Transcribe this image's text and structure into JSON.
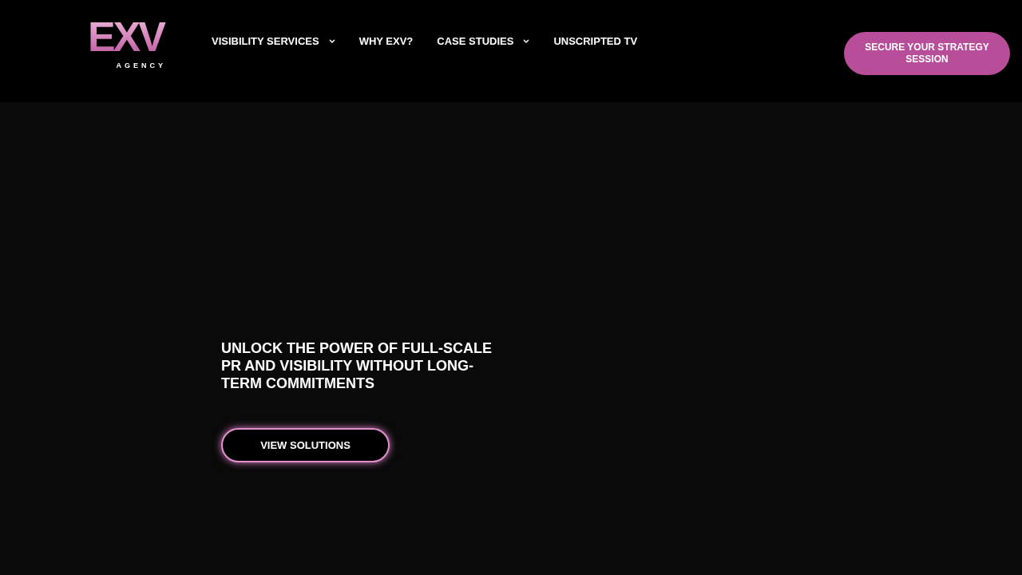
{
  "logo": {
    "mark": "EXV",
    "subtitle": "AGENCY"
  },
  "nav": [
    {
      "label": "VISIBILITY SERVICES",
      "has_dropdown": true
    },
    {
      "label": "WHY EXV?",
      "has_dropdown": false
    },
    {
      "label": "CASE STUDIES",
      "has_dropdown": true
    },
    {
      "label": "UNSCRIPTED TV",
      "has_dropdown": false
    }
  ],
  "cta": "SECURE YOUR STRATEGY SESSION",
  "hero": {
    "heading": "UNLOCK THE POWER OF FULL-SCALE PR AND VISIBILITY WITHOUT LONG-TERM COMMITMENTS",
    "button": "VIEW SOLUTIONS"
  }
}
